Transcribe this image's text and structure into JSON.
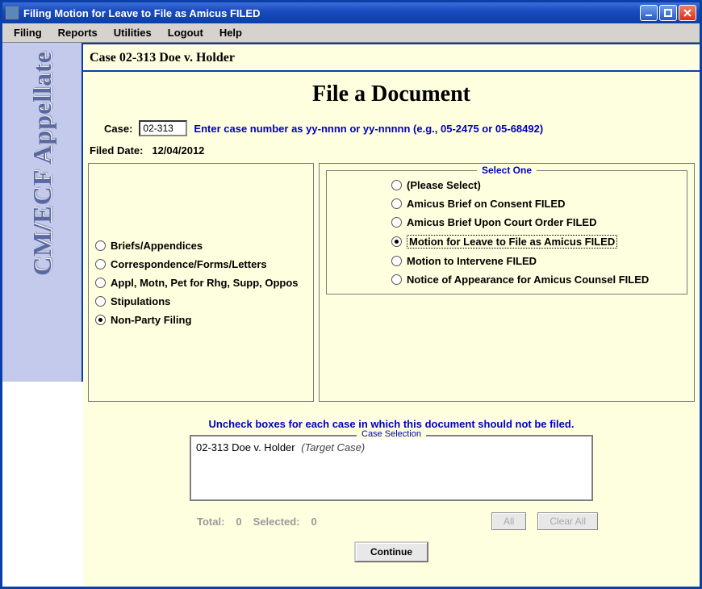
{
  "window": {
    "title": "Filing Motion for Leave to File as Amicus FILED"
  },
  "menubar": [
    "Filing",
    "Reports",
    "Utilities",
    "Logout",
    "Help"
  ],
  "sidebar": {
    "brand": "CM/ECF Appellate"
  },
  "case_header": "Case 02-313 Doe v. Holder",
  "page_title": "File a Document",
  "case_row": {
    "label": "Case:",
    "value": "02-313",
    "hint": "Enter case number as yy-nnnn or yy-nnnnn (e.g., 05-2475 or 05-68492)"
  },
  "filed_date": {
    "label": "Filed Date:",
    "value": "12/04/2012"
  },
  "left_panel": {
    "options": [
      {
        "label": "Briefs/Appendices",
        "selected": false
      },
      {
        "label": "Correspondence/Forms/Letters",
        "selected": false
      },
      {
        "label": "Appl, Motn, Pet for Rhg, Supp, Oppos",
        "selected": false
      },
      {
        "label": "Stipulations",
        "selected": false
      },
      {
        "label": "Non-Party Filing",
        "selected": true
      }
    ]
  },
  "right_panel": {
    "legend": "Select One",
    "options": [
      {
        "label": "(Please Select)",
        "selected": false
      },
      {
        "label": "Amicus Brief on Consent FILED",
        "selected": false
      },
      {
        "label": "Amicus Brief Upon Court Order FILED",
        "selected": false
      },
      {
        "label": "Motion for Leave to File as Amicus FILED",
        "selected": true
      },
      {
        "label": "Motion to Intervene FILED",
        "selected": false
      },
      {
        "label": "Notice of Appearance for Amicus Counsel FILED",
        "selected": false
      }
    ]
  },
  "uncheck_note": "Uncheck boxes for each case in which this document should not be filed.",
  "case_selection": {
    "legend": "Case Selection",
    "items": [
      {
        "text": "02-313 Doe v. Holder",
        "suffix": "(Target Case)"
      }
    ]
  },
  "totals": {
    "total_label": "Total:",
    "total_value": "0",
    "selected_label": "Selected:",
    "selected_value": "0",
    "all_button": "All",
    "clear_all_button": "Clear All"
  },
  "continue_button": "Continue"
}
